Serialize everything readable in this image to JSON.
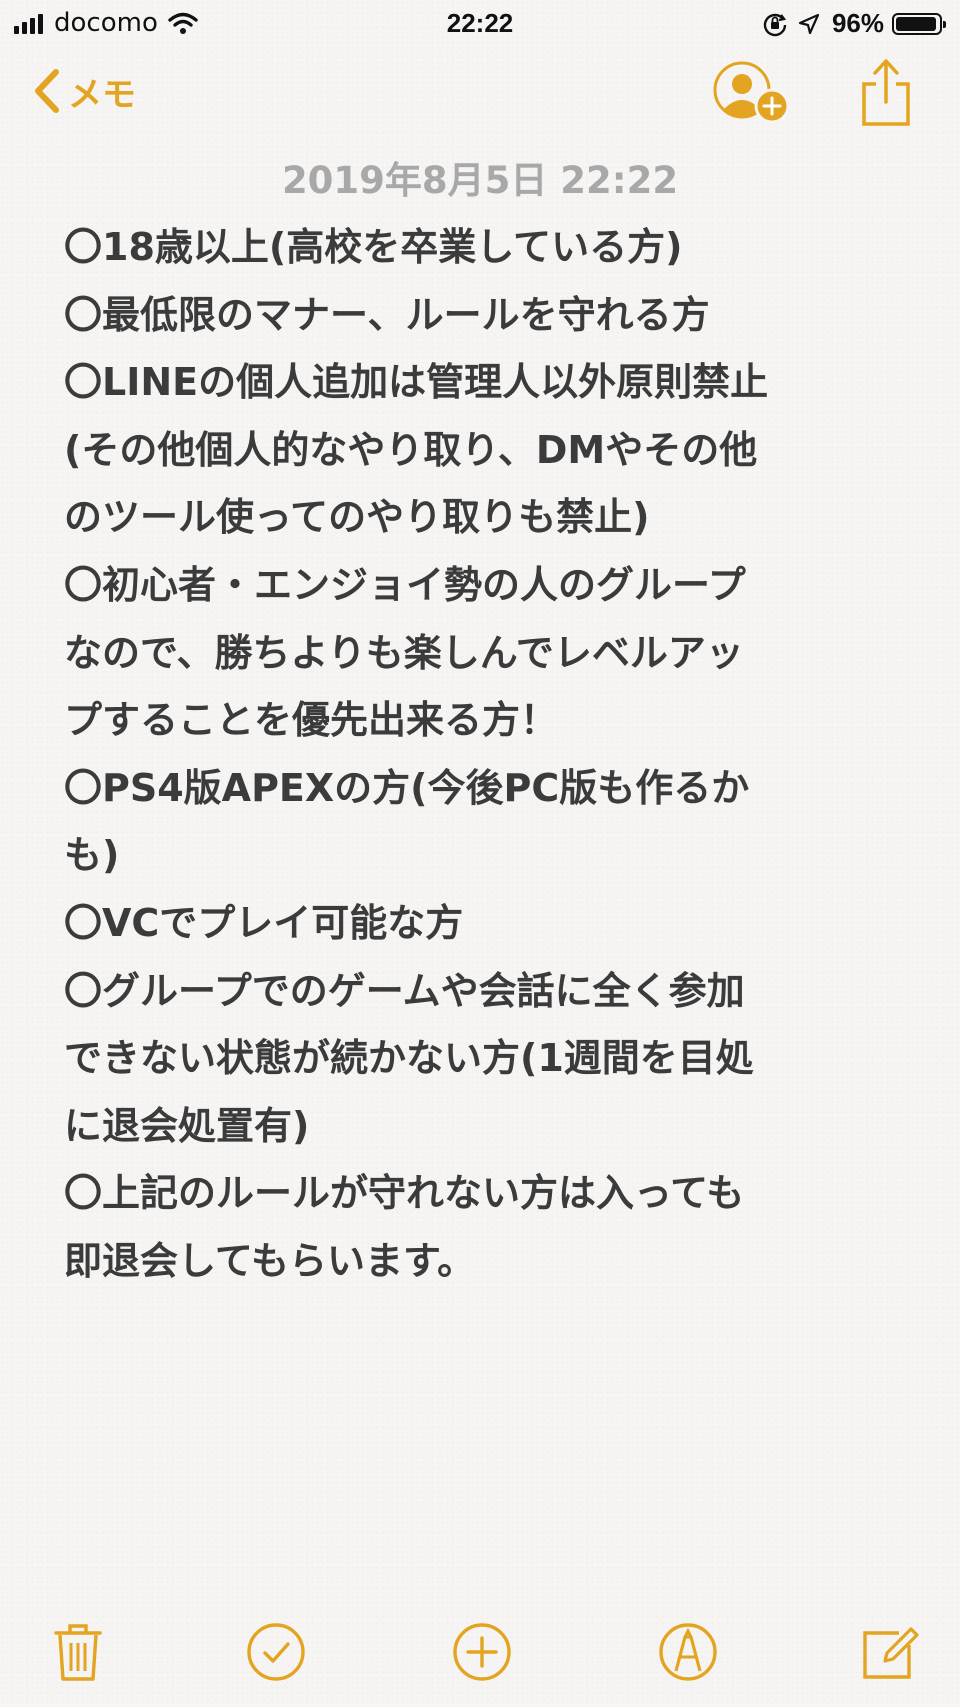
{
  "status_bar": {
    "carrier": "docomo",
    "time": "22:22",
    "battery_percent": "96%",
    "battery_level": 0.96,
    "icons": [
      "signal-icon",
      "wifi-icon",
      "orientation-lock-icon",
      "location-icon",
      "battery-icon"
    ]
  },
  "nav": {
    "back_label": "メモ",
    "icons": [
      "chevron-left-icon",
      "add-people-icon",
      "share-icon"
    ]
  },
  "note": {
    "date": "2019年8月5日 22:22",
    "lines": [
      "〇18歳以上(高校を卒業している方)",
      "〇最低限のマナー、ルールを守れる方",
      "〇LINEの個人追加は管理人以外原則禁止",
      "(その他個人的なやり取り、DMやその他",
      "のツール使ってのやり取りも禁止)",
      "〇初心者・エンジョイ勢の人のグループ",
      "なので、勝ちよりも楽しんでレベルアッ",
      "プすることを優先出来る方！",
      "〇PS4版APEXの方(今後PC版も作るか",
      "も)",
      "〇VCでプレイ可能な方",
      "〇グループでのゲームや会話に全く参加",
      "できない状態が続かない方(1週間を目処",
      "に退会処置有)",
      "〇上記のルールが守れない方は入っても",
      "即退会してもらいます。"
    ]
  },
  "toolbar": {
    "icons": [
      "trash-icon",
      "checklist-icon",
      "add-icon",
      "markup-icon",
      "compose-icon"
    ]
  },
  "colors": {
    "accent": "#e3a421",
    "text": "#3b3b3b",
    "date": "#a8a8a8",
    "background": "#f6f5f3"
  }
}
